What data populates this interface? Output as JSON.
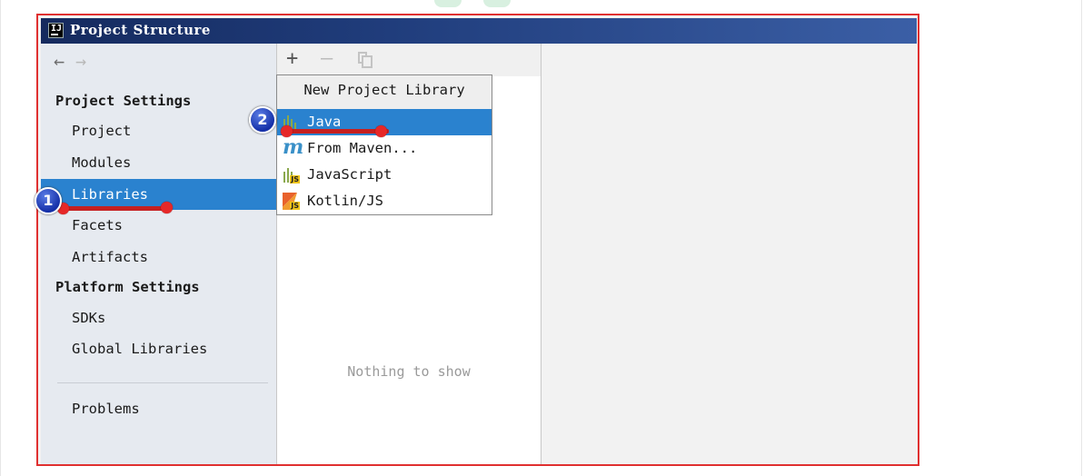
{
  "window": {
    "title": "Project Structure"
  },
  "nav": {
    "back_icon": "arrow-left-icon",
    "forward_icon": "arrow-right-icon",
    "project_settings_header": "Project Settings",
    "project_settings_items": [
      "Project",
      "Modules",
      "Libraries",
      "Facets",
      "Artifacts"
    ],
    "platform_settings_header": "Platform Settings",
    "platform_settings_items": [
      "SDKs",
      "Global Libraries"
    ],
    "problems_item": "Problems",
    "selected_item": "Libraries"
  },
  "toolbar": {
    "add_icon": "plus-icon",
    "remove_icon": "minus-icon",
    "copy_icon": "copy-icon"
  },
  "library_list": {
    "empty_text": "Nothing to show"
  },
  "popup": {
    "title": "New Project Library",
    "items": [
      {
        "label": "Java",
        "icon": "java-library-icon"
      },
      {
        "label": "From Maven...",
        "icon": "maven-icon"
      },
      {
        "label": "JavaScript",
        "icon": "javascript-library-icon"
      },
      {
        "label": "Kotlin/JS",
        "icon": "kotlin-js-icon"
      }
    ],
    "selected_item": "Java"
  },
  "annotations": {
    "step1": "1",
    "step2": "2"
  },
  "colors": {
    "selection": "#2a82cf",
    "title_bar": "#203d7c",
    "highlight_frame": "#e03030",
    "annotation_marker": "#1530a8",
    "annotation_underline": "#e62828"
  }
}
